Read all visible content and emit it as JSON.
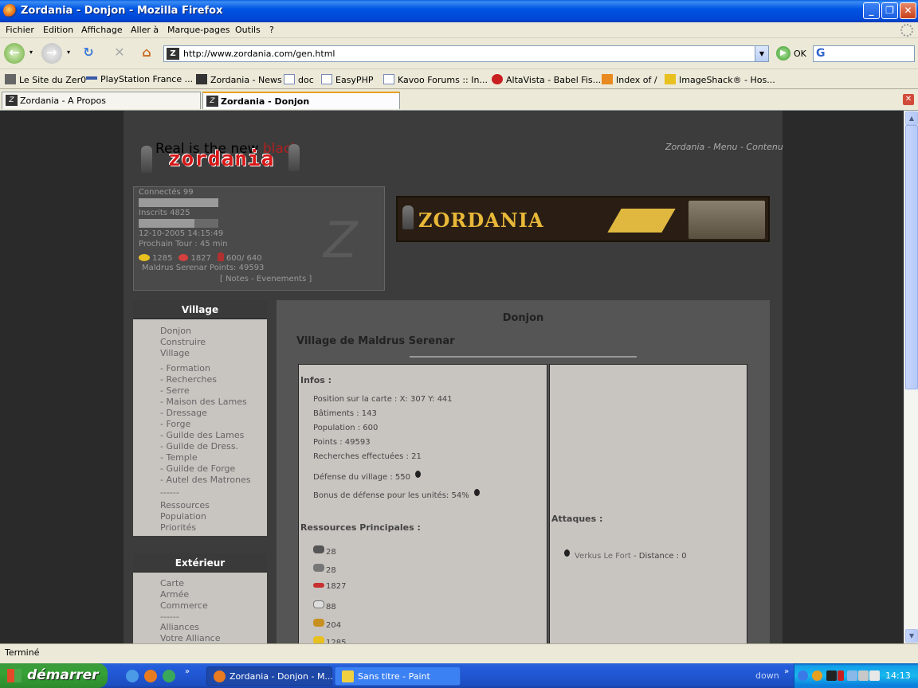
{
  "window": {
    "title": "Zordania - Donjon - Mozilla Firefox"
  },
  "menu": [
    "Fichier",
    "Edition",
    "Affichage",
    "Aller à",
    "Marque-pages",
    "Outils",
    "?"
  ],
  "nav": {
    "url": "http://www.zordania.com/gen.html",
    "ok_label": "OK"
  },
  "bookmarks": [
    "Le Site du Zer0",
    "PlayStation France ...",
    "Zordania - News",
    "doc",
    "EasyPHP",
    "Kavoo Forums :: In...",
    "AltaVista - Babel Fis...",
    "Index of /",
    "ImageShack® - Hos..."
  ],
  "tabs": [
    "Zordania - A Propos",
    "Zordania - Donjon"
  ],
  "page": {
    "logo_ghost": "Real is the new",
    "logo_ghost_red": "black",
    "logo_main": "zordania",
    "toplinks": "Zordania - Menu - Contenu",
    "stats": {
      "connectes": "Connectés 99",
      "inscrits": "Inscrits 4825",
      "connectes_fill": 1.0,
      "inscrits_fill": 0.7,
      "date": "12-10-2005 14:15:49",
      "prochain": "Prochain Tour : 45 min",
      "gold": "1285",
      "food": "1827",
      "pop": "600/ 640",
      "points": "Maldrus Serenar Points: 49593",
      "links": "[ Notes - Evenements ]"
    },
    "banner_title": "ZORDANIA",
    "village_menu": {
      "title": "Village",
      "items": [
        "Donjon",
        "Construire",
        "Village",
        " - Formation",
        " - Recherches",
        " - Serre",
        " - Maison des Lames",
        " - Dressage",
        " - Forge",
        " - Guilde des Lames",
        " - Guilde de Dress.",
        " - Temple",
        " - Guilde de Forge",
        " - Autel des Matrones",
        "------",
        "Ressources",
        "Population",
        "Priorités"
      ]
    },
    "exterieur_menu": {
      "title": "Extérieur",
      "items": [
        "Carte",
        "Armée",
        "Commerce",
        "------",
        "Alliances",
        "Votre Alliance"
      ]
    },
    "main": {
      "title": "Donjon",
      "subtitle": "Village de Maldrus Serenar",
      "infos_title": "Infos :",
      "infos": [
        "Position sur la carte : X: 307 Y: 441",
        "Bâtiments : 143",
        "Population : 600",
        "Points : 49593",
        "Recherches effectuées : 21",
        "Défense du village : 550",
        "Bonus de défense pour les unités: 54%"
      ],
      "ressources_title": "Ressources Principales :",
      "ressources": [
        {
          "value": "28",
          "color": "#555555"
        },
        {
          "value": "28",
          "color": "#777777"
        },
        {
          "value": "1827",
          "color": "#c83030"
        },
        {
          "value": "88",
          "color": "#dddddd"
        },
        {
          "value": "204",
          "color": "#c89020"
        },
        {
          "value": "1285",
          "color": "#e8c020"
        }
      ],
      "attaques_title": "Attaques :",
      "attaque_name": "Verkus Le Fort",
      "attaque_dist": " - Distance : 0"
    }
  },
  "status": "Terminé",
  "taskbar": {
    "start": "démarrer",
    "tasks": [
      "Zordania - Donjon - M...",
      "Sans titre - Paint"
    ],
    "down": "down",
    "clock": "14:13"
  }
}
